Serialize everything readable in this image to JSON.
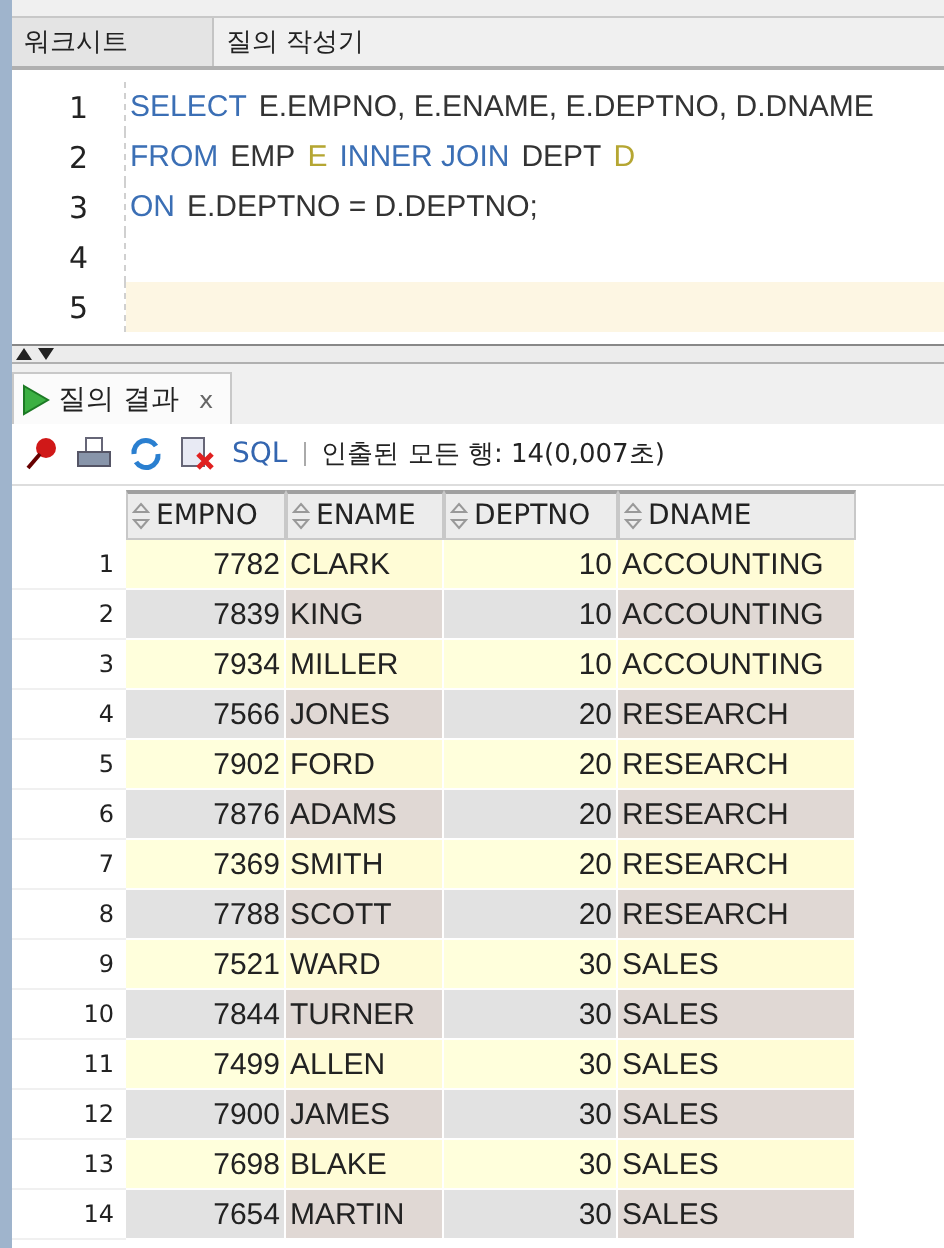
{
  "editor_tabs": [
    {
      "label": "워크시트",
      "selected": true
    },
    {
      "label": "질의 작성기",
      "selected": false
    }
  ],
  "editor": {
    "lines": [
      {
        "number": "1",
        "current": false,
        "tokens": [
          {
            "kind": "keyword",
            "text": "SELECT"
          },
          {
            "kind": "ident",
            "text": "E.EMPNO, E.ENAME, E.DEPTNO, D.DNAME"
          }
        ]
      },
      {
        "number": "2",
        "current": false,
        "tokens": [
          {
            "kind": "keyword",
            "text": "FROM"
          },
          {
            "kind": "ident",
            "text": "EMP"
          },
          {
            "kind": "alias",
            "text": "E"
          },
          {
            "kind": "keyword",
            "text": "INNER JOIN"
          },
          {
            "kind": "ident",
            "text": "DEPT"
          },
          {
            "kind": "alias",
            "text": "D"
          }
        ]
      },
      {
        "number": "3",
        "current": false,
        "tokens": [
          {
            "kind": "keyword",
            "text": "ON"
          },
          {
            "kind": "ident",
            "text": "E.DEPTNO = D.DEPTNO;"
          }
        ]
      },
      {
        "number": "4",
        "current": false
      },
      {
        "number": "5",
        "current": true
      }
    ]
  },
  "results_tab": {
    "label": "질의 결과",
    "close": "x"
  },
  "toolbar": {
    "sql_link": "SQL",
    "status": "인출된 모든 행: 14(0,007초)"
  },
  "table": {
    "columns": [
      "EMPNO",
      "ENAME",
      "DEPTNO",
      "DNAME"
    ],
    "rows": [
      {
        "index": "1",
        "cells": [
          "7782",
          "CLARK",
          "10",
          "ACCOUNTING"
        ]
      },
      {
        "index": "2",
        "cells": [
          "7839",
          "KING",
          "10",
          "ACCOUNTING"
        ]
      },
      {
        "index": "3",
        "cells": [
          "7934",
          "MILLER",
          "10",
          "ACCOUNTING"
        ]
      },
      {
        "index": "4",
        "cells": [
          "7566",
          "JONES",
          "20",
          "RESEARCH"
        ]
      },
      {
        "index": "5",
        "cells": [
          "7902",
          "FORD",
          "20",
          "RESEARCH"
        ]
      },
      {
        "index": "6",
        "cells": [
          "7876",
          "ADAMS",
          "20",
          "RESEARCH"
        ]
      },
      {
        "index": "7",
        "cells": [
          "7369",
          "SMITH",
          "20",
          "RESEARCH"
        ]
      },
      {
        "index": "8",
        "cells": [
          "7788",
          "SCOTT",
          "20",
          "RESEARCH"
        ]
      },
      {
        "index": "9",
        "cells": [
          "7521",
          "WARD",
          "30",
          "SALES"
        ]
      },
      {
        "index": "10",
        "cells": [
          "7844",
          "TURNER",
          "30",
          "SALES"
        ]
      },
      {
        "index": "11",
        "cells": [
          "7499",
          "ALLEN",
          "30",
          "SALES"
        ]
      },
      {
        "index": "12",
        "cells": [
          "7900",
          "JAMES",
          "30",
          "SALES"
        ]
      },
      {
        "index": "13",
        "cells": [
          "7698",
          "BLAKE",
          "30",
          "SALES"
        ]
      },
      {
        "index": "14",
        "cells": [
          "7654",
          "MARTIN",
          "30",
          "SALES"
        ]
      }
    ]
  }
}
